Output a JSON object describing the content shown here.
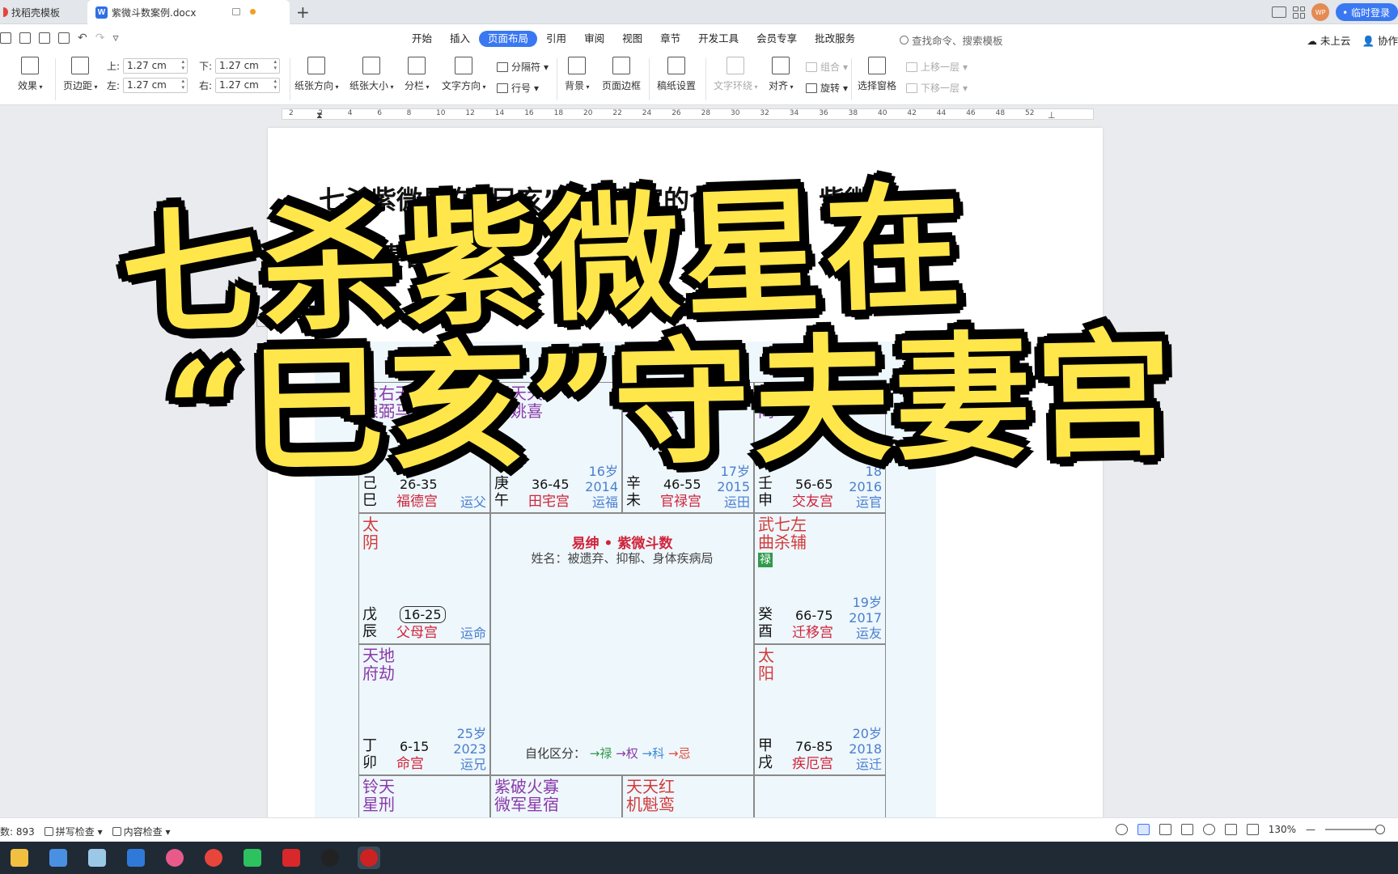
{
  "tabs": {
    "tab1_label": "找稻壳模板",
    "tab2_label": "紫微斗数案例.docx",
    "new_tab": "+"
  },
  "window": {
    "avatar": "WP",
    "login_label": "• 临时登录"
  },
  "ribbon_tabs": {
    "items": [
      "开始",
      "插入",
      "页面布局",
      "引用",
      "审阅",
      "视图",
      "章节",
      "开发工具",
      "会员专享",
      "批改服务"
    ],
    "active": "页面布局",
    "search_placeholder": "查找命令、搜索模板",
    "cloud": "未上云",
    "collab": "协作"
  },
  "ribbon": {
    "effects": "效果",
    "margins": "页边距",
    "margin_top_label": "上:",
    "margin_top": "1.27 cm",
    "margin_bottom_label": "下:",
    "margin_bottom": "1.27 cm",
    "margin_left_label": "左:",
    "margin_left": "1.27 cm",
    "margin_right_label": "右:",
    "margin_right": "1.27 cm",
    "orientation": "纸张方向",
    "size": "纸张大小",
    "columns": "分栏",
    "text_direction": "文字方向",
    "breaks": "分隔符",
    "line_numbers": "行号",
    "background": "背景",
    "page_border": "页面边框",
    "grid_paper": "稿纸设置",
    "text_wrap": "文字环绕",
    "align": "对齐",
    "group": "组合",
    "rotate": "旋转",
    "selection_pane": "选择窗格",
    "bring_forward": "上移一层",
    "send_backward": "下移一层"
  },
  "ruler": {
    "numbers": [
      "2",
      "2",
      "4",
      "6",
      "8",
      "10",
      "12",
      "14",
      "16",
      "18",
      "20",
      "22",
      "24",
      "26",
      "28",
      "30",
      "32",
      "34",
      "36",
      "38",
      "40",
      "42",
      "44",
      "46",
      "48",
      "52"
    ]
  },
  "document": {
    "title_line1": "七杀紫微星在“巳亥”守夫妻宫的含义讲解。紫微斗",
    "title_line2": "妻宫"
  },
  "chart": {
    "center_title": "易绅 • 紫微斗数",
    "center_name": "姓名：被遗弃、抑郁、身体疾病局",
    "legend_label": "自化区分：",
    "legend_items": [
      {
        "label": "禄",
        "color": "#2f9a4a"
      },
      {
        "label": "权",
        "color": "#8a3aa8"
      },
      {
        "label": "科",
        "color": "#3a8ad8"
      },
      {
        "label": "忌",
        "color": "#e24a3a"
      }
    ],
    "cells": {
      "si": {
        "stars": "贪右天\n狼弼马",
        "ganzhi": "己\n巳",
        "age": "26-35",
        "palace": "福德宫",
        "yun": "运父",
        "year": ""
      },
      "wu": {
        "stars": "禄天天\n存姚喜",
        "ganzhi": "庚\n午",
        "age": "36-45",
        "palace": "田宅宫",
        "yun": "运福",
        "year": "16岁\n2014"
      },
      "wei": {
        "stars": "天擎地\n相羊空",
        "ganzhi": "辛\n未",
        "age": "46-55",
        "palace": "官禄宫",
        "yun": "运田",
        "year": "17岁\n2015"
      },
      "shen": {
        "stars": "天\n同",
        "ganzhi": "壬\n申",
        "age": "56-65",
        "palace": "交友宫",
        "yun": "运官",
        "year": "18\n2016"
      },
      "chen": {
        "stars": "太\n阴",
        "ganzhi": "戊\n辰",
        "age": "16-25",
        "palace": "父母宫",
        "yun": "运命",
        "year": ""
      },
      "you": {
        "stars": "武七左\n曲杀辅",
        "hua": "禄",
        "ganzhi": "癸\n酉",
        "age": "66-75",
        "palace": "迁移宫",
        "yun": "运友",
        "year": "19岁\n2017"
      },
      "mao": {
        "stars": "天地\n府劫",
        "ganzhi": "丁\n卯",
        "age": "6-15",
        "palace": "命宫",
        "yun": "运兄",
        "year": "25岁\n2023"
      },
      "xu": {
        "stars": "太\n阳",
        "ganzhi": "甲\n戌",
        "age": "76-85",
        "palace": "疾厄宫",
        "yun": "运迁",
        "year": "20岁\n2018"
      },
      "yin": {
        "stars": "铃天\n星刑"
      },
      "chou": {
        "stars": "紫破火寡\n微军星宿"
      },
      "zi": {
        "stars": "天天红\n机魁鸾"
      }
    }
  },
  "overlay": {
    "line1": "七杀紫微星在",
    "line2": "“巳亥”守夫妻宫",
    "fill": "#ffe64a",
    "stroke": "#000000"
  },
  "status": {
    "word_count": "数: 893",
    "spell_check": "拼写检查",
    "content_check": "内容检查",
    "zoom": "130%"
  },
  "colors": {
    "accent": "#3a78f2",
    "palace_red": "#d0243a",
    "star_purple": "#8a3aa8",
    "year_blue": "#4a7fcf"
  }
}
